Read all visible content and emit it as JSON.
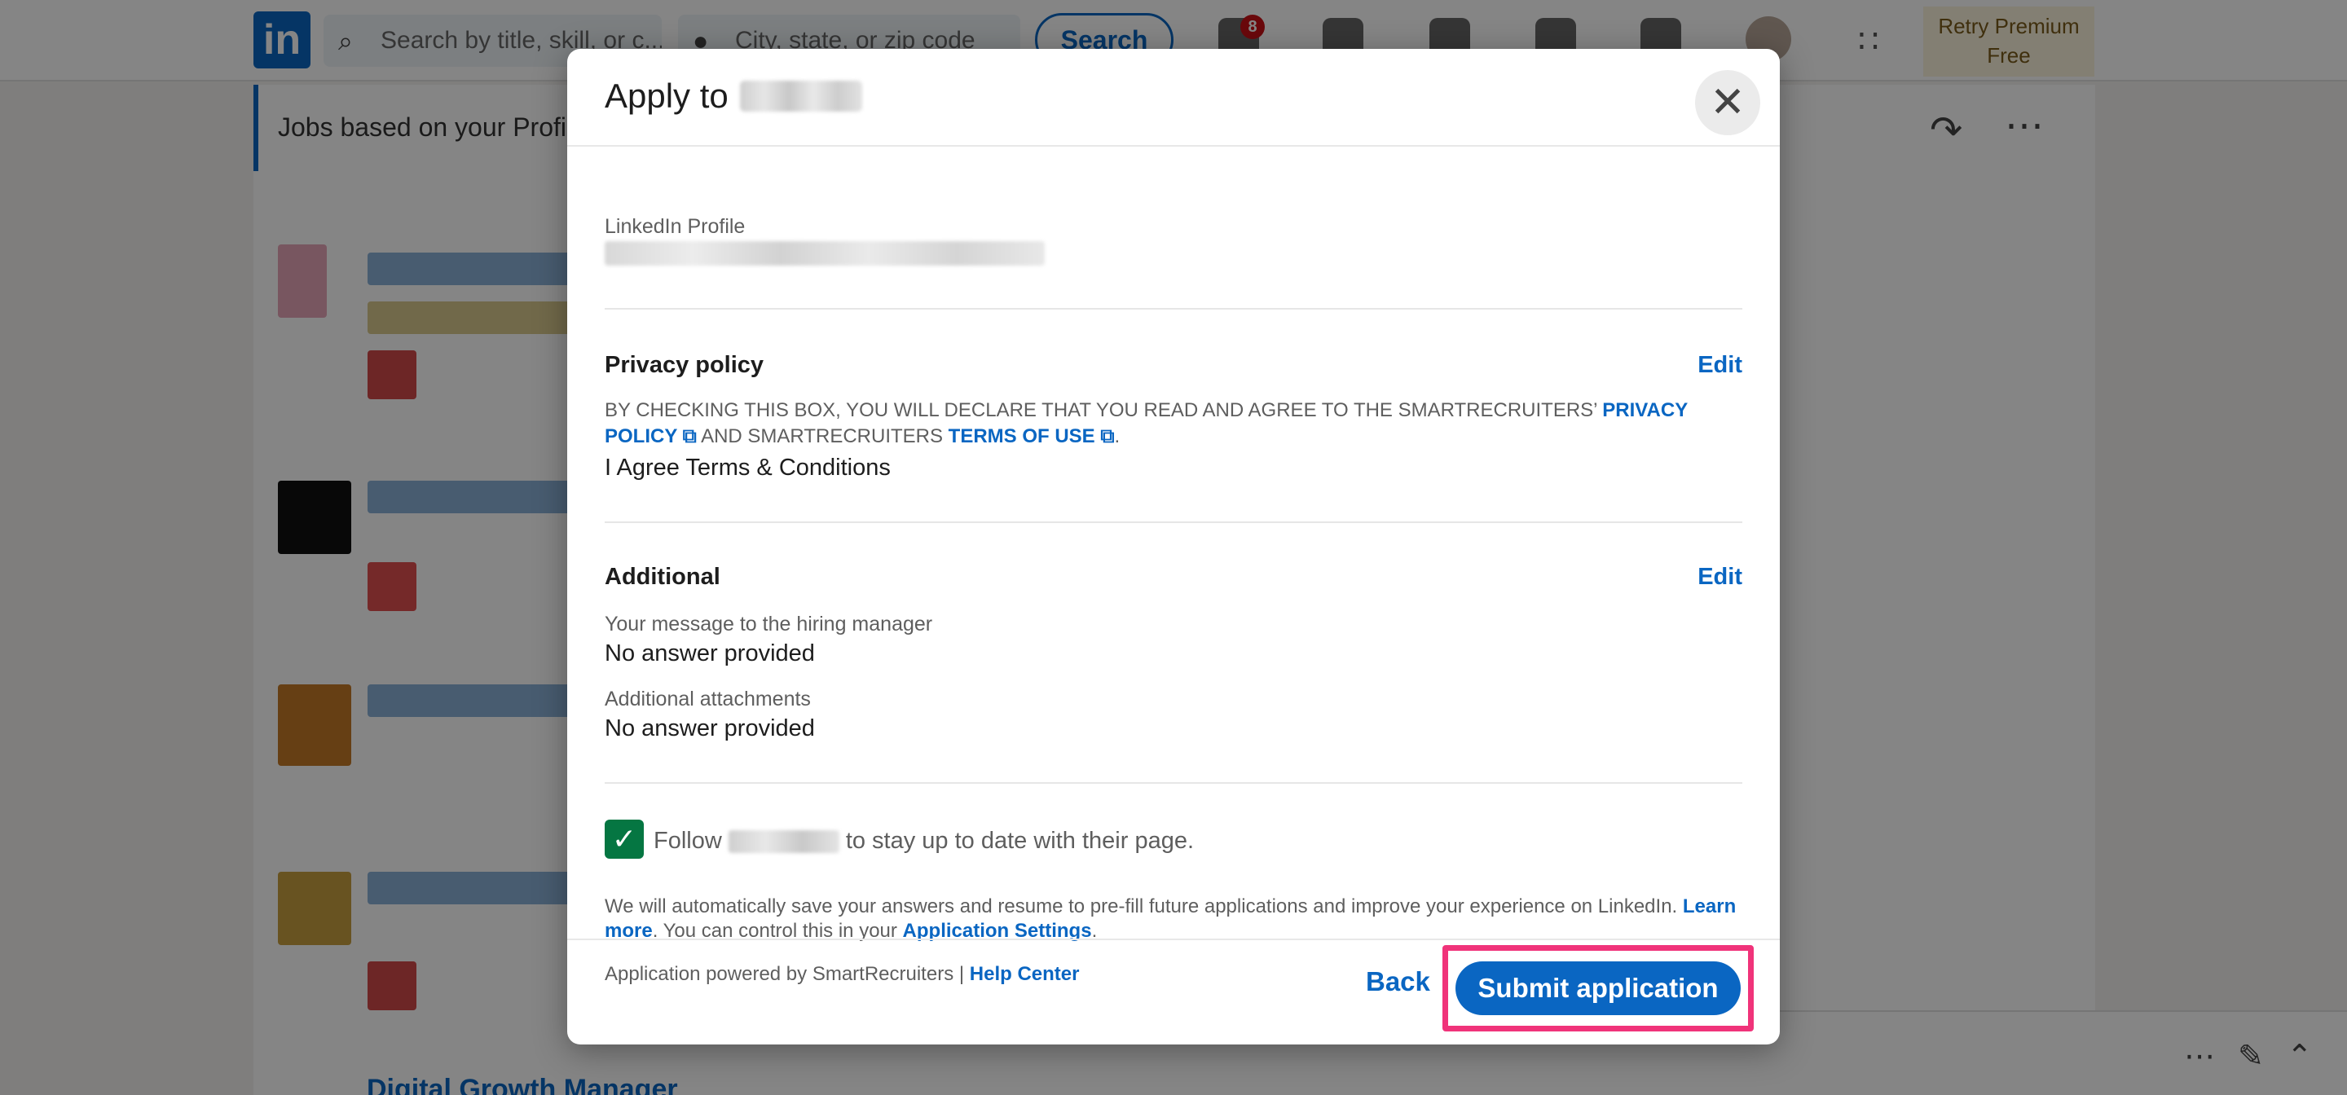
{
  "nav": {
    "logo": "in",
    "search_placeholder": "Search by title, skill, or c...",
    "location_placeholder": "City, state, or zip code",
    "search_button": "Search",
    "notification_count": "8",
    "premium_line1": "Retry Premium",
    "premium_line2": "Free"
  },
  "background": {
    "jobs_banner": "Jobs based on your Profi",
    "bottom_job_title": "Digital Growth Manager"
  },
  "modal": {
    "title_prefix": "Apply to",
    "linkedin_profile_label": "LinkedIn Profile",
    "privacy": {
      "title": "Privacy policy",
      "edit": "Edit",
      "text_before": "By checking this box, you will declare that you read and agree to the SmartRecruiters’ ",
      "privacy_link": "Privacy Policy",
      "text_middle": " and SmartRecruiters ",
      "terms_link": "Terms of Use",
      "text_end": ".",
      "agreement": "I Agree Terms & Conditions"
    },
    "additional": {
      "title": "Additional",
      "edit": "Edit",
      "message_label": "Your message to the hiring manager",
      "message_value": "No answer provided",
      "attachments_label": "Additional attachments",
      "attachments_value": "No answer provided"
    },
    "follow": {
      "checked": true,
      "prefix": "Follow",
      "suffix": "to stay up to date with their page."
    },
    "footer_note": {
      "text_before": "We will automatically save your answers and resume to pre-fill future applications and improve your experience on LinkedIn. ",
      "learn_more": "Learn more",
      "text_middle": ". You can control this in your ",
      "settings_link": "Application Settings",
      "text_end": "."
    },
    "powered_by": {
      "text": "Application powered by SmartRecruiters | ",
      "help_link": "Help Center"
    },
    "back_button": "Back",
    "submit_button": "Submit application"
  },
  "colors": {
    "brand_blue": "#0a66c2",
    "check_green": "#057642",
    "highlight_pink": "#f0337a"
  }
}
